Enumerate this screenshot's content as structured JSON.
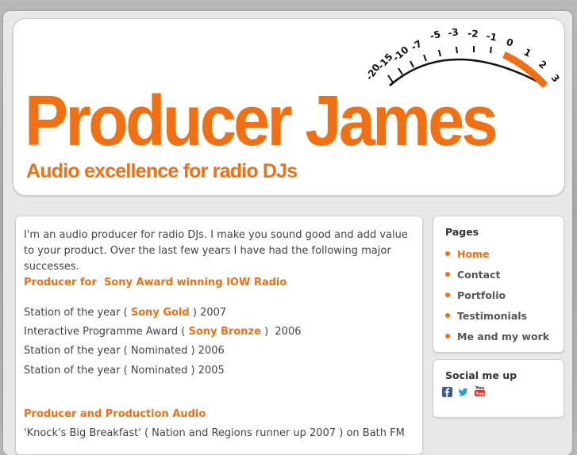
{
  "header": {
    "title": "Producer James",
    "tagline": "Audio excellence for radio DJs",
    "meter_scale": [
      "-20",
      "-15",
      "-10",
      "-7",
      "-5",
      "-3",
      "-2",
      "-1",
      "0",
      "1",
      "2",
      "3"
    ]
  },
  "main": {
    "intro": "I'm an audio producer for radio DJs. I make you sound good and add value to your product. Over the last few years I have had the following major successes.",
    "section1_heading": "Producer for  Sony Award winning IOW Radio",
    "awards": [
      {
        "before": "Station of the year ( ",
        "highlight": "Sony Gold",
        "after": " ) 2007"
      },
      {
        "before": "Interactive Programme Award ( ",
        "highlight": "Sony Bronze",
        "after": " )  2006"
      },
      {
        "before": "Station of the year ( Nominated ) 2006",
        "highlight": "",
        "after": ""
      },
      {
        "before": "Station of the year ( Nominated ) 2005",
        "highlight": "",
        "after": ""
      }
    ],
    "section2_heading": "Producer and Production Audio",
    "cut_line": "'Knock's Big Breakfast' ( Nation and Regions runner up 2007 ) on Bath FM"
  },
  "sidebar": {
    "pages_title": "Pages",
    "pages": [
      {
        "label": "Home",
        "active": true
      },
      {
        "label": "Contact",
        "active": false
      },
      {
        "label": "Portfolio",
        "active": false
      },
      {
        "label": "Testimonials",
        "active": false
      },
      {
        "label": "Me and my work",
        "active": false
      }
    ],
    "social_title": "Social me up",
    "social_icons": [
      "facebook-icon",
      "twitter-icon",
      "youtube-icon"
    ]
  },
  "colors": {
    "accent": "#f26f12",
    "text": "#444444",
    "panel": "#ffffff",
    "frame": "#e8e8e8"
  }
}
